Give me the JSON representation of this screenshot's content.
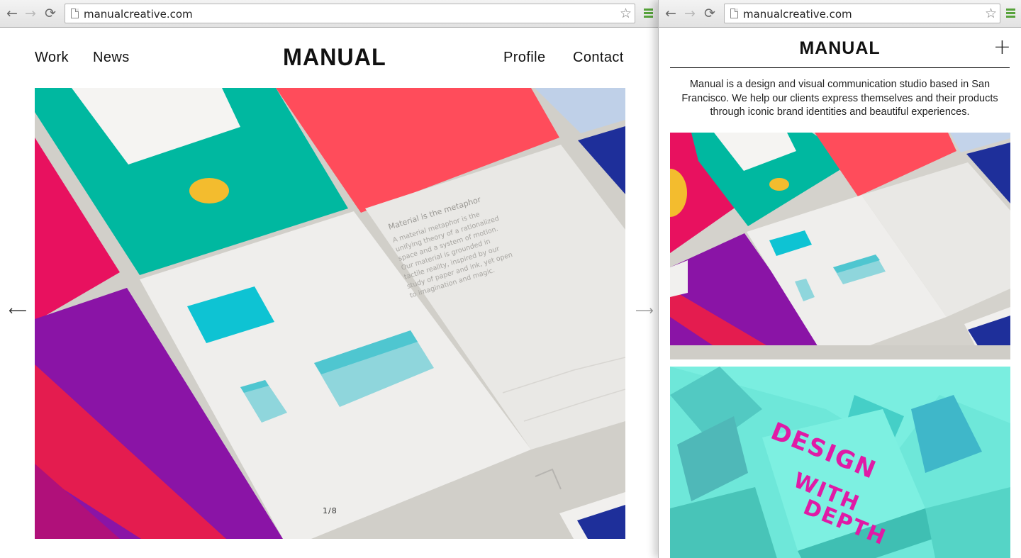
{
  "left_window": {
    "url": "manualcreative.com",
    "nav_back": "←",
    "nav_forward": "→",
    "reload": "⟳",
    "bookmark": "☆",
    "site": {
      "nav_work": "Work",
      "nav_news": "News",
      "logo": "MANUAL",
      "nav_profile": "Profile",
      "nav_contact": "Contact",
      "prev_arrow": "⟵",
      "next_arrow": "⟶",
      "slide_counter": "1/8"
    }
  },
  "right_window": {
    "url": "manualcreative.com",
    "nav_back": "←",
    "nav_forward": "→",
    "reload": "⟳",
    "bookmark": "☆",
    "site": {
      "logo": "MANUAL",
      "menu_toggle": "+",
      "about": "Manual is a design and visual communication studio based in San Francisco. We help our clients express themselves and their products through iconic brand identities and beautiful experiences."
    }
  },
  "artwork_text": {
    "hero_card_title": "Material is the metaphor",
    "hero_card_body": [
      "A material metaphor is the",
      "unifying theory of a rationalized",
      "space and a system of motion.",
      "Our material is grounded in",
      "tactile reality, inspired by our",
      "study of paper and ink, yet open",
      "to imagination and magic."
    ],
    "design_with_depth": [
      "DESIGN",
      "WITH",
      "DEPTH"
    ]
  },
  "colors": {
    "teal": "#00b8a0",
    "coral": "#ff4c5b",
    "magenta": "#e8115f",
    "purple": "#8a14a6",
    "cyan": "#0ec3d3",
    "yellow": "#f3bc2e",
    "navy": "#1e2f9a",
    "mint": "#6ee7d9",
    "chrome_menu_green": "#56a23a"
  }
}
